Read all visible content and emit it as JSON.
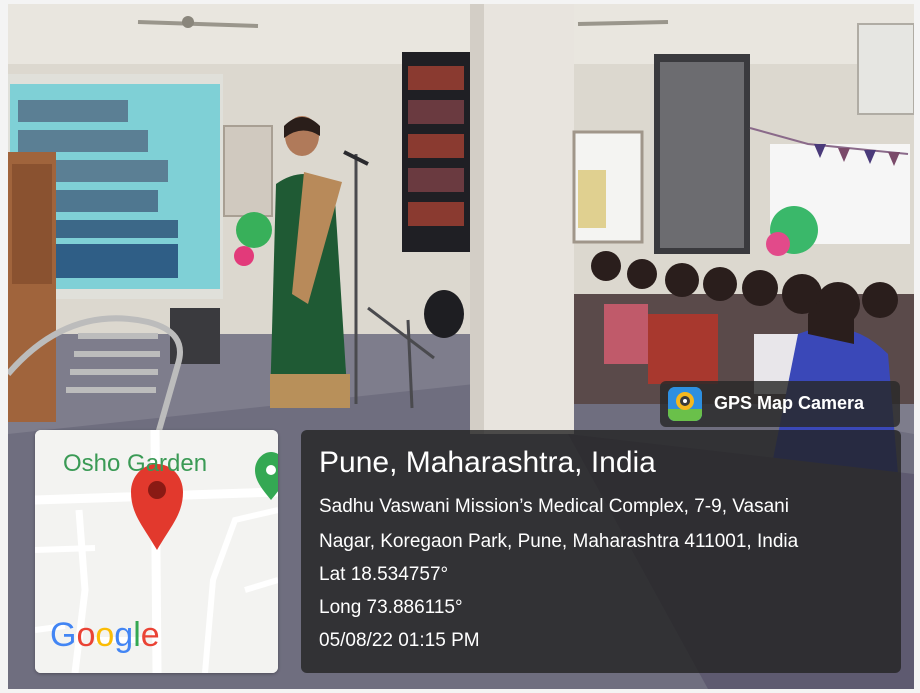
{
  "badge": {
    "icon": "gps-map-camera-icon",
    "label": "GPS Map Camera"
  },
  "map": {
    "place_label": "Osho Garden",
    "logo": {
      "g1": "G",
      "o1": "o",
      "o2": "o",
      "g2": "g",
      "l": "l",
      "e": "e"
    },
    "pin_icon": "location-pin-icon",
    "poi_icon": "park-icon"
  },
  "location": {
    "title": "Pune, Maharashtra, India",
    "address_line1": "Sadhu Vaswani Mission’s Medical Complex, 7-9, Vasani",
    "address_line2": "Nagar, Koregaon Park, Pune, Maharashtra 411001, India",
    "lat": "Lat 18.534757°",
    "long": "Long 73.886115°",
    "datetime": "05/08/22 01:15 PM"
  },
  "colors": {
    "map_label": "#3a9a55",
    "pin": "#e2392d",
    "badge_bg": "#282828",
    "info_bg": "#232323"
  }
}
